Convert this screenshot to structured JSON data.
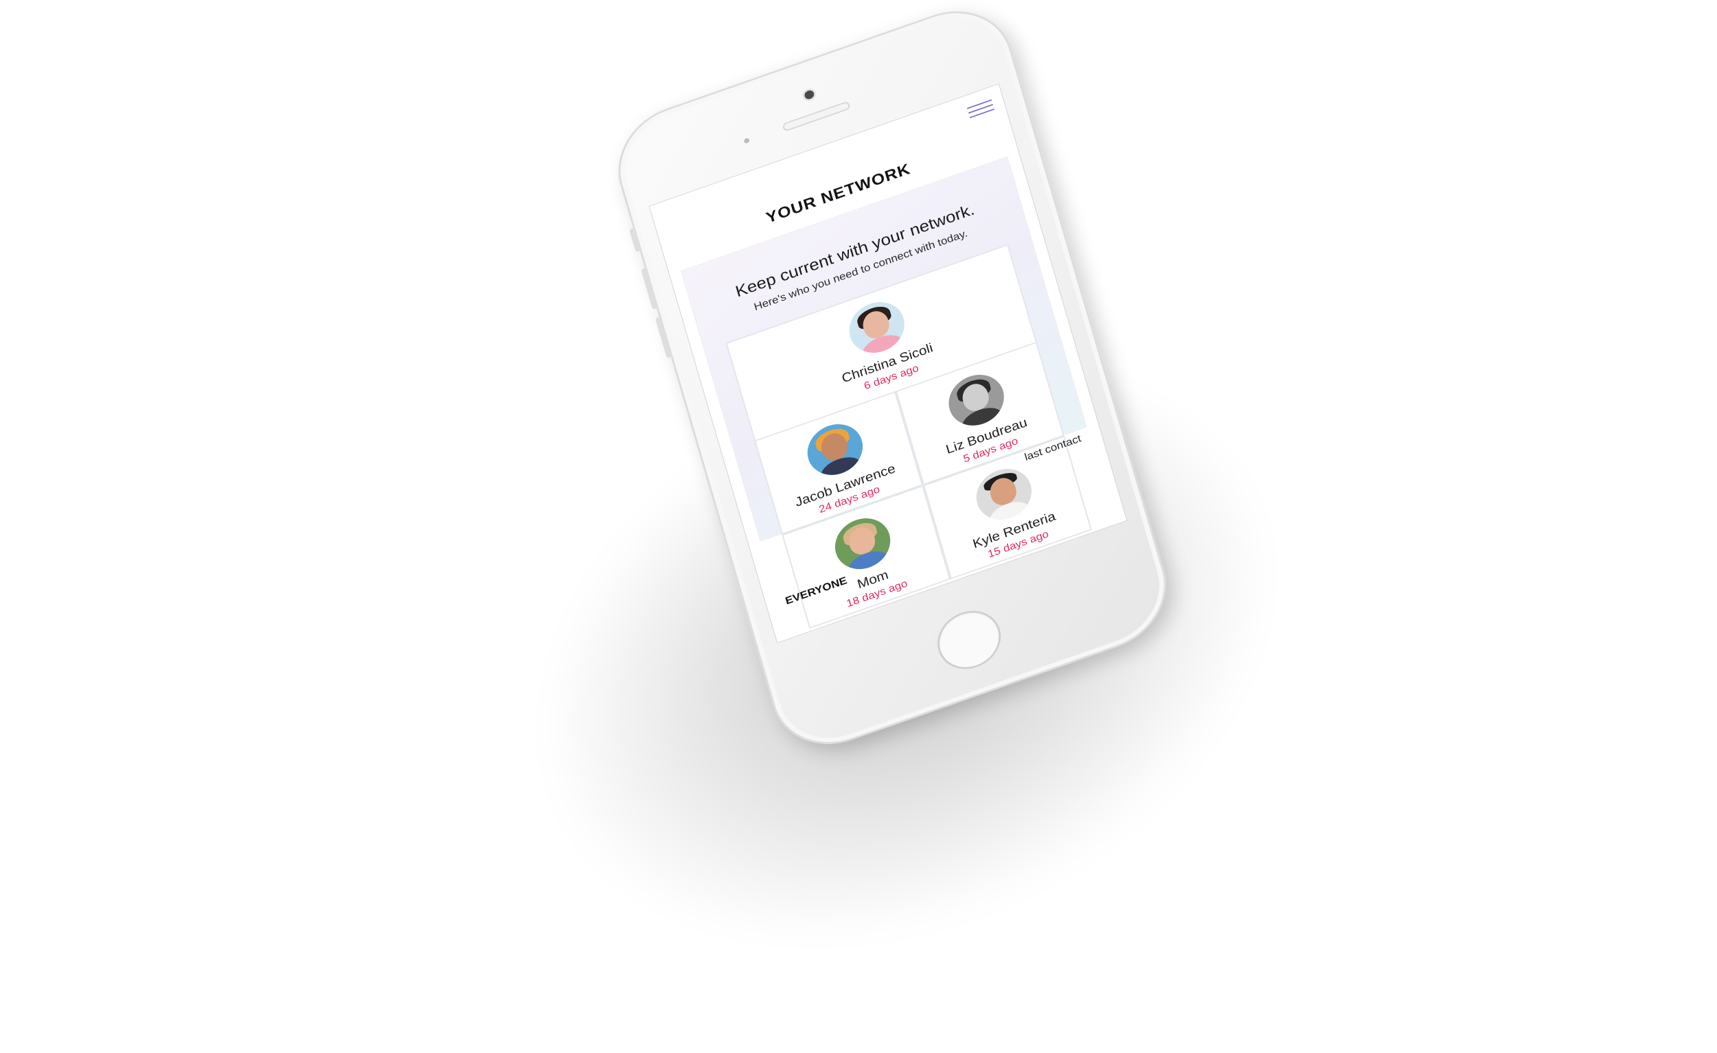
{
  "header": {
    "title": "YOUR NETWORK",
    "menu_icon": "hamburger-icon"
  },
  "intro": {
    "headline": "Keep current with your network.",
    "subline": "Here's who you need to connect with today."
  },
  "contacts": [
    {
      "name": "Christina Sicoli",
      "last_contact": "6 days ago"
    },
    {
      "name": "Liz Boudreau",
      "last_contact": "5 days ago"
    },
    {
      "name": "Jacob Lawrence",
      "last_contact": "24 days ago"
    },
    {
      "name": "Kyle Renteria",
      "last_contact": "15 days ago"
    },
    {
      "name": "Mom",
      "last_contact": "18 days ago"
    }
  ],
  "sort": {
    "label": "last contact"
  },
  "footer_tabs": [
    {
      "label": "EVERYONE"
    }
  ],
  "colors": {
    "accent_pink": "#e8285e",
    "menu_purple": "#7a6ad6",
    "panel_gradient": [
      "#f6f3fb",
      "#e7f3f7"
    ]
  }
}
